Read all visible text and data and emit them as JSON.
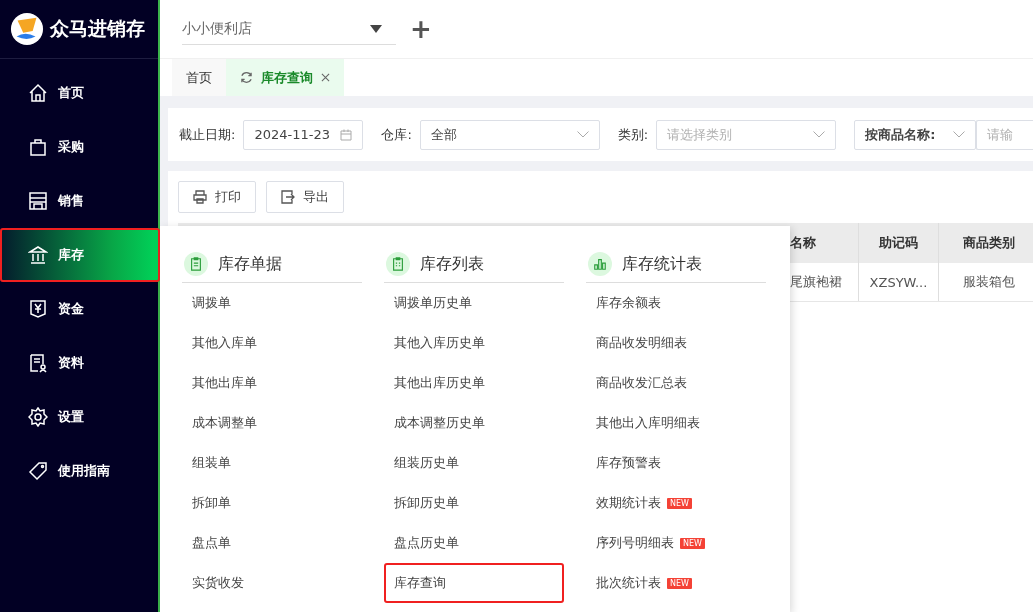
{
  "app": {
    "name": "众马进销存"
  },
  "sidebar": {
    "items": [
      {
        "label": "首页",
        "selected": false,
        "annotated": false
      },
      {
        "label": "采购",
        "selected": false,
        "annotated": false
      },
      {
        "label": "销售",
        "selected": false,
        "annotated": false
      },
      {
        "label": "库存",
        "selected": true,
        "annotated": true
      },
      {
        "label": "资金",
        "selected": false,
        "annotated": false
      },
      {
        "label": "资料",
        "selected": false,
        "annotated": false
      },
      {
        "label": "设置",
        "selected": false,
        "annotated": false
      },
      {
        "label": "使用指南",
        "selected": false,
        "annotated": false
      }
    ]
  },
  "store_select": {
    "value": "小小便利店",
    "add": "+"
  },
  "tabs": [
    {
      "label": "首页",
      "selected": false
    },
    {
      "label": "库存查询",
      "selected": true
    }
  ],
  "filters": {
    "date_label": "截止日期:",
    "date": "2024-11-23",
    "warehouse_label": "仓库:",
    "warehouse": "全部",
    "category_label": "类别:",
    "category_placeholder": "请选择类别",
    "search_by": "按商品名称:",
    "search_placeholder": "请输"
  },
  "toolbar": [
    {
      "label": "打印"
    },
    {
      "label": "导出"
    }
  ],
  "table": {
    "columns": [
      "名称",
      "助记码",
      "商品类别"
    ],
    "rows": [
      [
        "尾旗袍裙",
        "XZSYW...",
        "服装箱包"
      ]
    ]
  },
  "menu": {
    "columns": [
      {
        "title": "库存单据",
        "items": [
          {
            "label": "调拨单",
            "annotated": false
          },
          {
            "label": "其他入库单",
            "annotated": false
          },
          {
            "label": "其他出库单",
            "annotated": false
          },
          {
            "label": "成本调整单",
            "annotated": false
          },
          {
            "label": "组装单",
            "annotated": false
          },
          {
            "label": "拆卸单",
            "annotated": false
          },
          {
            "label": "盘点单",
            "annotated": false
          },
          {
            "label": "实货收发",
            "annotated": false
          }
        ]
      },
      {
        "title": "库存列表",
        "items": [
          {
            "label": "调拨单历史单",
            "annotated": false
          },
          {
            "label": "其他入库历史单",
            "annotated": false
          },
          {
            "label": "其他出库历史单",
            "annotated": false
          },
          {
            "label": "成本调整历史单",
            "annotated": false
          },
          {
            "label": "组装历史单",
            "annotated": false
          },
          {
            "label": "拆卸历史单",
            "annotated": false
          },
          {
            "label": "盘点历史单",
            "annotated": false
          },
          {
            "label": "库存查询",
            "annotated": true
          }
        ]
      },
      {
        "title": "库存统计表",
        "items": [
          {
            "label": "库存余额表",
            "annotated": false
          },
          {
            "label": "商品收发明细表",
            "annotated": false
          },
          {
            "label": "商品收发汇总表",
            "annotated": false
          },
          {
            "label": "其他出入库明细表",
            "annotated": false
          },
          {
            "label": "库存预警表",
            "annotated": false
          },
          {
            "label": "效期统计表",
            "badge": "NEW",
            "annotated": false
          },
          {
            "label": "序列号明细表",
            "badge": "NEW",
            "annotated": false
          },
          {
            "label": "批次统计表",
            "badge": "NEW",
            "annotated": false
          }
        ]
      }
    ]
  }
}
